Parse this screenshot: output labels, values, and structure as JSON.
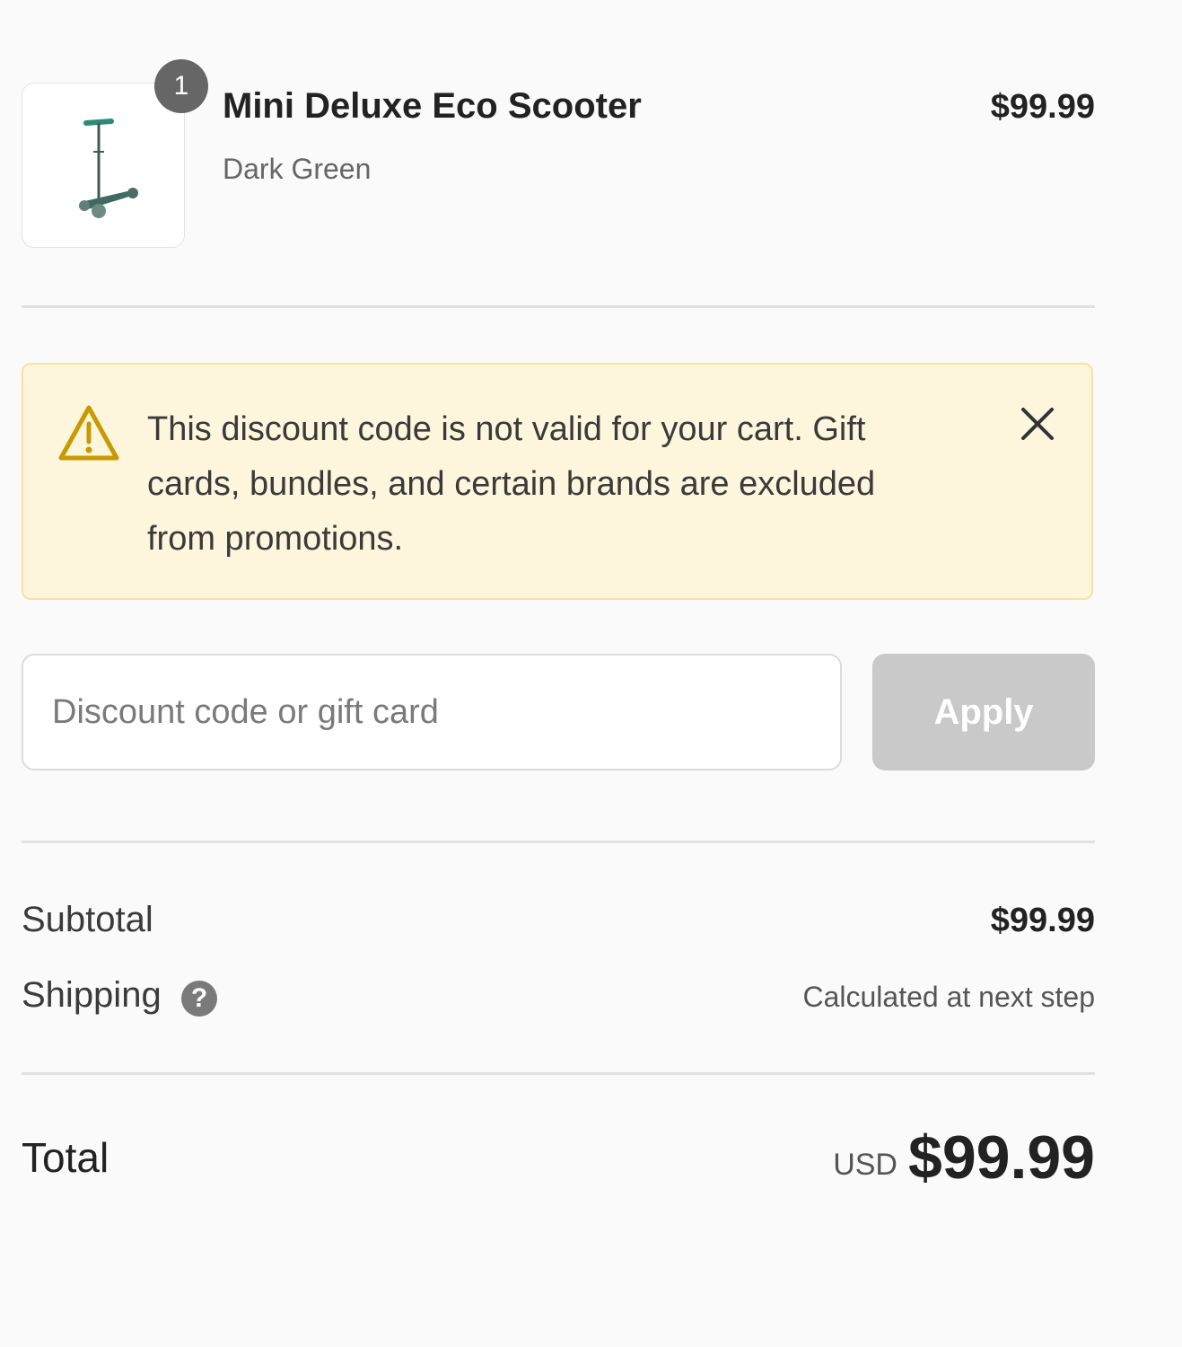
{
  "line_item": {
    "quantity": "1",
    "name": "Mini Deluxe Eco Scooter",
    "variant": "Dark Green",
    "price": "$99.99",
    "image_icon": "scooter-icon"
  },
  "alert": {
    "icon": "warning-icon",
    "message": "This discount code is not valid for your cart. Gift cards, bundles, and certain brands are excluded from promotions.",
    "close_icon": "close-icon",
    "colors": {
      "background": "#fef5dd",
      "border": "#f4e2a8",
      "icon": "#c79a00"
    }
  },
  "discount": {
    "placeholder": "Discount code or gift card",
    "value": "",
    "apply_label": "Apply"
  },
  "totals": {
    "subtotal_label": "Subtotal",
    "subtotal_value": "$99.99",
    "shipping_label": "Shipping",
    "shipping_help_icon": "question-icon",
    "shipping_value": "Calculated at next step",
    "total_label": "Total",
    "currency": "USD",
    "total_value": "$99.99"
  }
}
